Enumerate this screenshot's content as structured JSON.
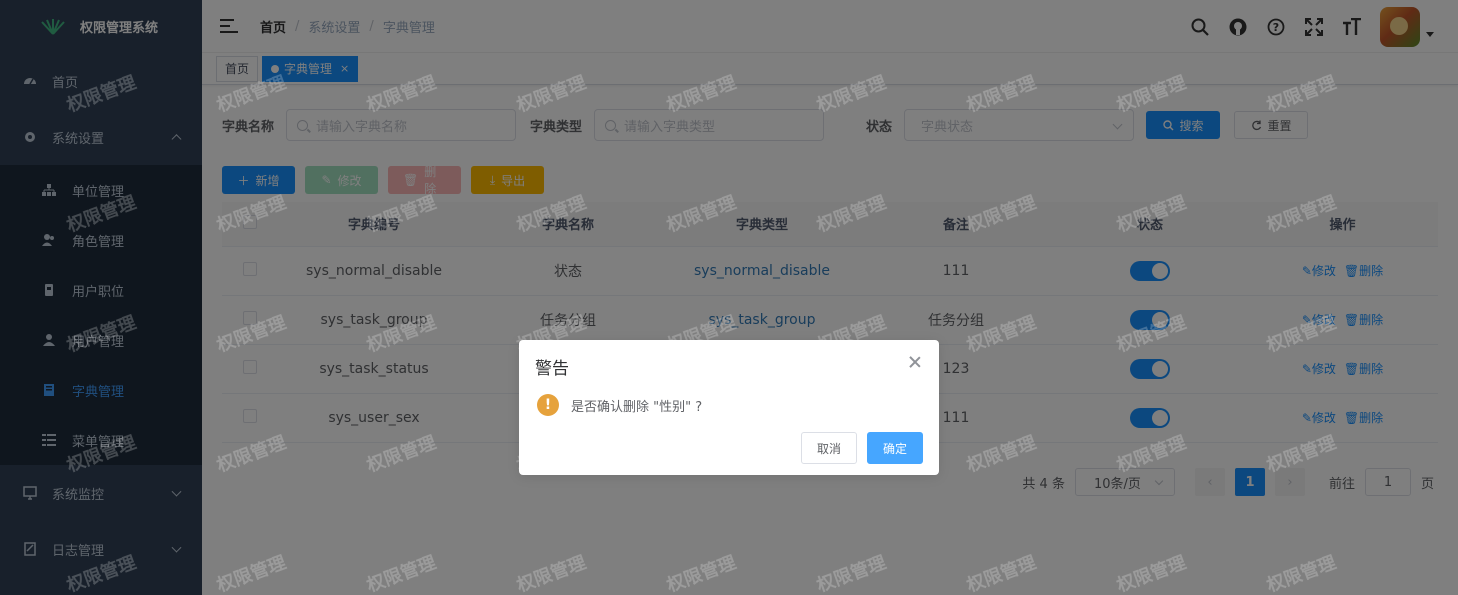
{
  "app": {
    "title": "权限管理系统"
  },
  "sidebar": {
    "items": [
      {
        "label": "首页",
        "icon": "dashboard-icon"
      },
      {
        "label": "系统设置",
        "icon": "gear-icon",
        "expanded": true,
        "children": [
          {
            "label": "单位管理",
            "icon": "tree-icon"
          },
          {
            "label": "角色管理",
            "icon": "peoples-icon"
          },
          {
            "label": "用户职位",
            "icon": "post-icon"
          },
          {
            "label": "用户管理",
            "icon": "user-icon"
          },
          {
            "label": "字典管理",
            "icon": "dict-icon",
            "active": true
          },
          {
            "label": "菜单管理",
            "icon": "tree-table-icon"
          }
        ]
      },
      {
        "label": "系统监控",
        "icon": "monitor-icon"
      },
      {
        "label": "日志管理",
        "icon": "log-icon"
      }
    ]
  },
  "header": {
    "breadcrumb": [
      "首页",
      "系统设置",
      "字典管理"
    ],
    "icons": [
      "search-icon",
      "github-icon",
      "question-icon",
      "fullscreen-icon",
      "font-size-icon"
    ]
  },
  "tags": [
    {
      "label": "首页",
      "active": false
    },
    {
      "label": "字典管理",
      "active": true,
      "close": "×"
    }
  ],
  "search": {
    "dict_name_label": "字典名称",
    "dict_name_placeholder": "请输入字典名称",
    "dict_type_label": "字典类型",
    "dict_type_placeholder": "请输入字典类型",
    "status_label": "状态",
    "status_placeholder": "字典状态",
    "search_btn": "搜索",
    "reset_btn": "重置"
  },
  "toolbar": {
    "add": "新增",
    "edit": "修改",
    "delete": "删除",
    "export": "导出"
  },
  "table": {
    "columns": [
      "字典编号",
      "字典名称",
      "字典类型",
      "备注",
      "状态",
      "操作"
    ],
    "rows": [
      {
        "code": "sys_normal_disable",
        "name": "状态",
        "type": "sys_normal_disable",
        "remark": "111",
        "status": true
      },
      {
        "code": "sys_task_group",
        "name": "任务分组",
        "type": "sys_task_group",
        "remark": "任务分组",
        "status": true
      },
      {
        "code": "sys_task_status",
        "name": "",
        "type": "",
        "remark": "123",
        "status": true
      },
      {
        "code": "sys_user_sex",
        "name": "",
        "type": "",
        "remark": "111",
        "status": true
      }
    ],
    "edit_label": "修改",
    "delete_label": "删除"
  },
  "pagination": {
    "total": "共 4 条",
    "page_size": "10条/页",
    "current": "1",
    "goto_prefix": "前往",
    "goto_value": "1",
    "goto_suffix": "页"
  },
  "dialog": {
    "title": "警告",
    "message": "是否确认删除 \"性别\" ?",
    "cancel": "取消",
    "confirm": "确定",
    "icon": "!"
  },
  "watermark": "权限管理",
  "colors": {
    "sidebar_bg": "#304156",
    "primary": "#1890ff",
    "warning": "#e6a23c"
  }
}
